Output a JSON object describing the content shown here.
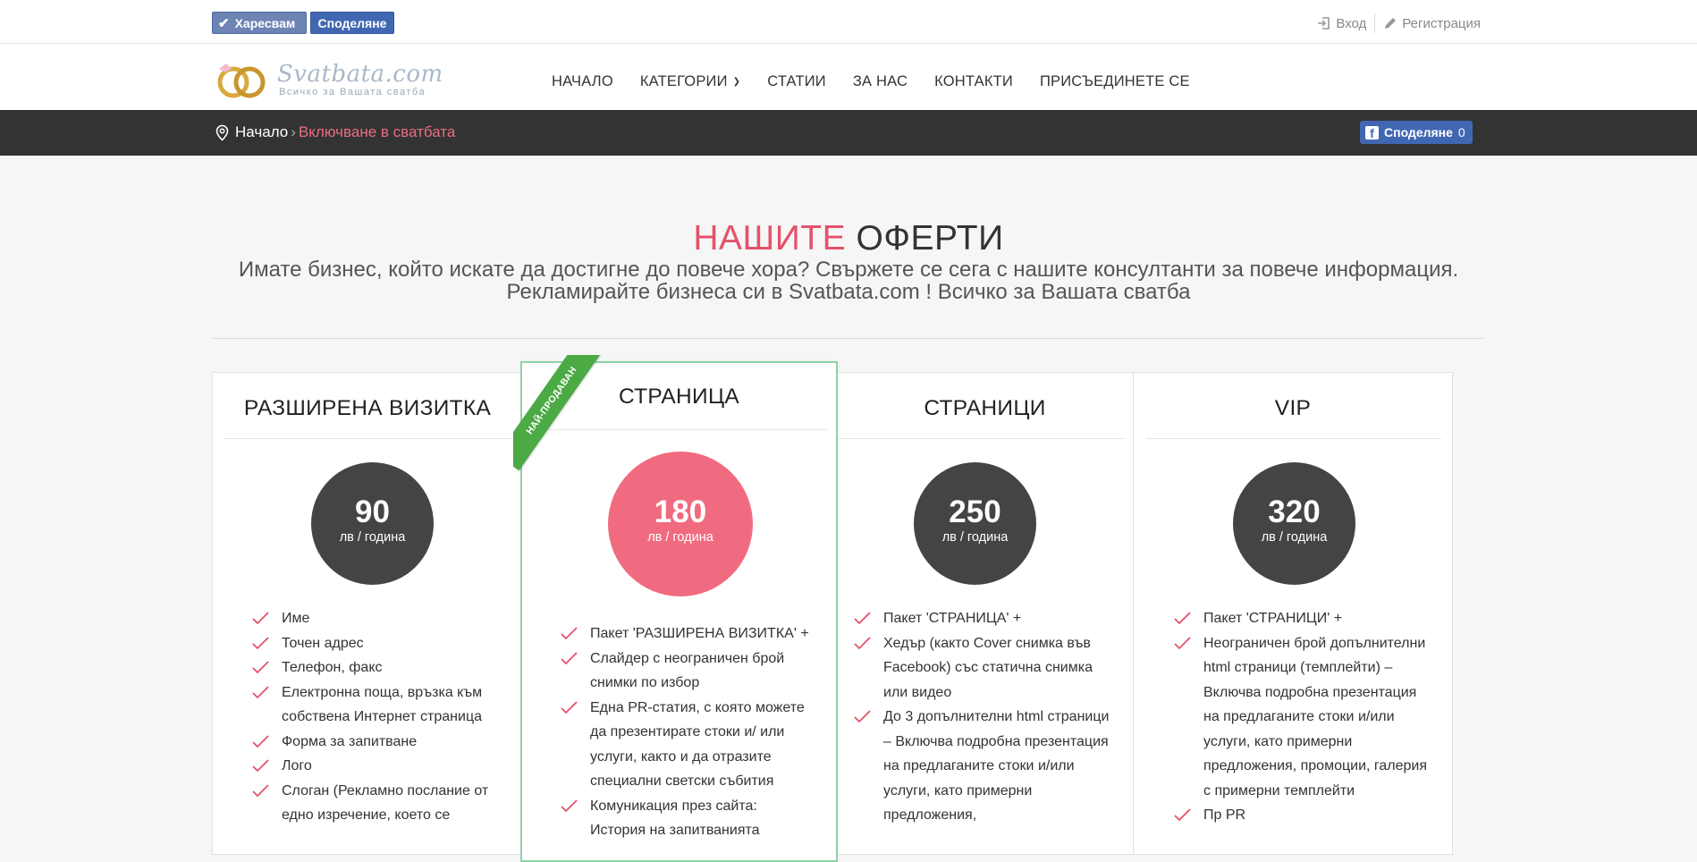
{
  "topbar": {
    "like_label": "Харесвам",
    "share_label": "Споделяне",
    "login_label": "Вход",
    "register_label": "Регистрация"
  },
  "header": {
    "logo_text": "Svatbata.com",
    "logo_tagline": "Всичко за Вашата сватба",
    "nav": [
      "НАЧАЛО",
      "КАТЕГОРИИ",
      "СТАТИИ",
      "ЗА НАС",
      "КОНТАКТИ",
      "ПРИСЪЕДИНЕТЕ СЕ"
    ]
  },
  "breadcrumb": {
    "home": "Начало",
    "separator": "›",
    "current": "Включване в сватбата",
    "share_label": "Споделяне",
    "share_count": "0"
  },
  "hero": {
    "title_accent": "НАШИТЕ",
    "title_rest": "ОФЕРТИ",
    "subtitle_line1": "Имате бизнес, който искате да достигне до повече хора? Свържете се сега с нашите консултанти за повече информация.",
    "subtitle_line2": "Рекламирайте бизнеса си в Svatbata.com ! Всичко за Вашата сватба"
  },
  "colors": {
    "accent": "#e3526b",
    "featured_circle": "#f06b7f",
    "dark_circle": "#444444",
    "ribbon": "#4caa44",
    "featured_border": "#8dd3a4",
    "facebook": "#4267b2",
    "crumb_bar": "#333333"
  },
  "plans": [
    {
      "title": "РАЗШИРЕНА ВИЗИТКА",
      "price": "90",
      "period": "лв / година",
      "features": [
        "Име",
        "Точен адрес",
        "Телефон, факс",
        "Електронна поща, връзка към собствена Интернет страница",
        "Форма за запитване",
        "Лого",
        "Слоган (Рекламно послание от едно изречение, което се"
      ]
    },
    {
      "title": "СТРАНИЦА",
      "ribbon": "НАЙ-ПРОДАВАН",
      "price": "180",
      "period": "лв / година",
      "features": [
        "Пакет 'РАЗШИРЕНА ВИЗИТКА' +",
        "Слайдер с неограничен брой снимки по избор",
        "Една PR-статия, с която можете да презентирате стоки и/ или услуги, както и да отразите специални светски събития",
        "Комуникация през сайта: История на запитванията"
      ]
    },
    {
      "title": "СТРАНИЦИ",
      "price": "250",
      "period": "лв / година",
      "features": [
        "Пакет 'СТРАНИЦА' +",
        "Хедър (както Cover снимка във Facebook) със статична снимка или видео",
        "До 3 допълнителни html страници – Включва подробна презентация на предлаганите стоки и/или услуги, като примерни предложения,"
      ]
    },
    {
      "title": "VIP",
      "price": "320",
      "period": "лв / година",
      "features": [
        "Пакет 'СТРАНИЦИ' +",
        "Неограничен брой допълнителни html страници (темплейти) – Включва подробна презентация на предлаганите стоки и/или услуги, като примерни предложения, промоции, галерия с примерни темплейти",
        "Пр PR"
      ]
    }
  ]
}
